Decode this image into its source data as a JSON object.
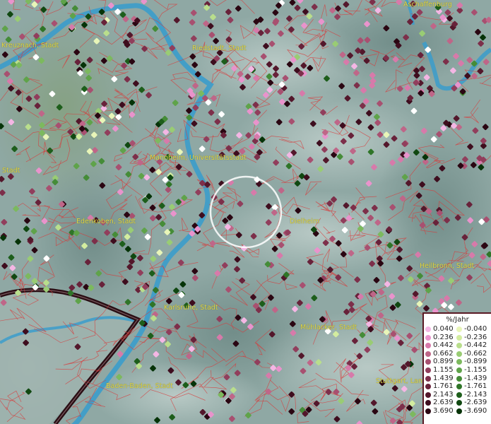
{
  "legend": {
    "title": "%/Jahr",
    "rows": [
      {
        "pos": "0.040",
        "neg": "-0.040",
        "pos_color": "#f4b6e4",
        "neg_color": "#e8f5b8"
      },
      {
        "pos": "0.236",
        "neg": "-0.236",
        "pos_color": "#e993cc",
        "neg_color": "#d3ec9f"
      },
      {
        "pos": "0.442",
        "neg": "-0.442",
        "pos_color": "#d77aaa",
        "neg_color": "#b9de8c"
      },
      {
        "pos": "0.662",
        "neg": "-0.662",
        "pos_color": "#bf6688",
        "neg_color": "#99cc74"
      },
      {
        "pos": "0.899",
        "neg": "-0.899",
        "pos_color": "#a85070",
        "neg_color": "#7cb95e"
      },
      {
        "pos": "1.155",
        "neg": "-1.155",
        "pos_color": "#913e5c",
        "neg_color": "#5fa34a"
      },
      {
        "pos": "1.439",
        "neg": "-1.439",
        "pos_color": "#7d2f4a",
        "neg_color": "#458c38"
      },
      {
        "pos": "1.761",
        "neg": "-1.761",
        "pos_color": "#68223a",
        "neg_color": "#2f7528"
      },
      {
        "pos": "2.143",
        "neg": "-2.143",
        "pos_color": "#53172b",
        "neg_color": "#1d5e1b"
      },
      {
        "pos": "2.639",
        "neg": "-2.639",
        "pos_color": "#3e0d1e",
        "neg_color": "#104811"
      },
      {
        "pos": "3.690",
        "neg": "-3.690",
        "pos_color": "#2a0612",
        "neg_color": "#063308"
      }
    ]
  },
  "cities": [
    {
      "id": "aschaffenburg",
      "label": "Aschaffenburg"
    },
    {
      "id": "kreuznach",
      "label": "Kreuznach, Stadt"
    },
    {
      "id": "riedstadt",
      "label": "Riedstadt, Stadt"
    },
    {
      "id": "mannheim",
      "label": "Mannheim, Universitätsstadt"
    },
    {
      "id": "stadt-west",
      "label": "Stadt"
    },
    {
      "id": "edenkoben",
      "label": "Edenkoben, Stadt"
    },
    {
      "id": "dielheim",
      "label": "Dielheim"
    },
    {
      "id": "heilbronn",
      "label": "Heilbronn, Stadt"
    },
    {
      "id": "karlsruhe",
      "label": "Karlsruhe, Stadt"
    },
    {
      "id": "muehlacker",
      "label": "Mühlacker, Stadt"
    },
    {
      "id": "stuttgart",
      "label": "Stuttgart, Land"
    },
    {
      "id": "baden-baden",
      "label": "Baden-Baden, Stadt"
    }
  ],
  "colors": {
    "terrain": "#8fa8a4",
    "river": "#3b9ccb",
    "boundary": "#d83a3a",
    "highlight_ring": "#ffffff",
    "city_label": "#e3d84a"
  }
}
